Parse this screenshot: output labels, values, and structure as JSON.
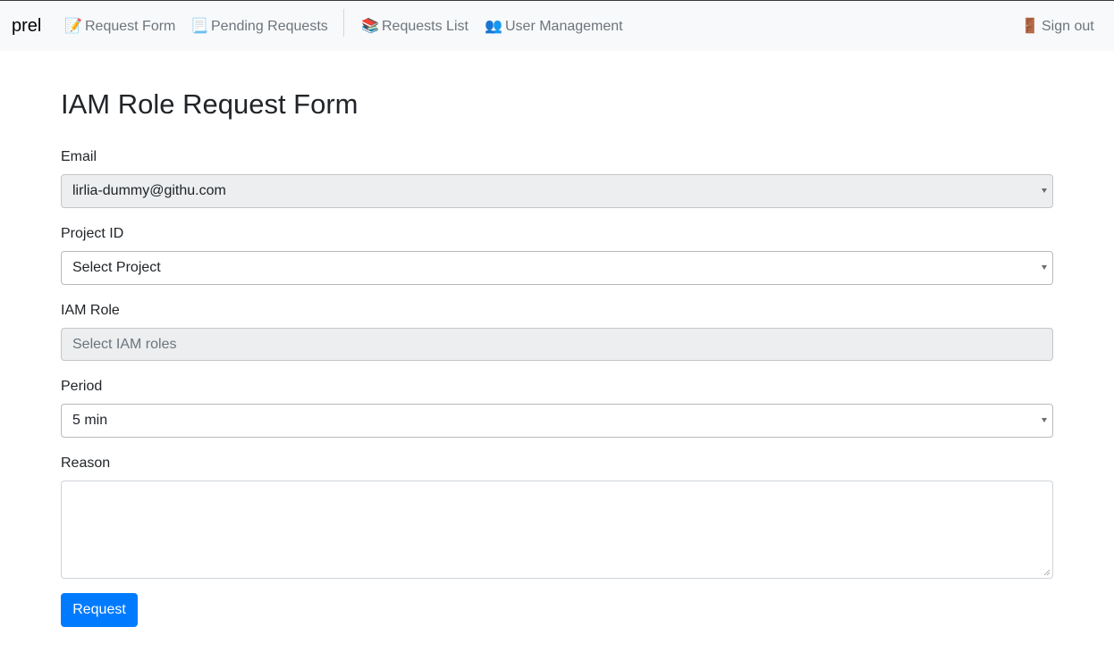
{
  "app": {
    "brand": "prel"
  },
  "nav": {
    "items": [
      {
        "icon": "memo-icon",
        "glyph": "📝",
        "label": "Request Form"
      },
      {
        "icon": "page-icon",
        "glyph": "📃",
        "label": "Pending Requests"
      },
      {
        "icon": "books-icon",
        "glyph": "📚",
        "label": "Requests List"
      },
      {
        "icon": "users-icon",
        "glyph": "👥",
        "label": "User Management"
      }
    ],
    "sign_out": {
      "icon": "door-icon",
      "glyph": "🚪",
      "label": "Sign out"
    }
  },
  "form": {
    "title": "IAM Role Request Form",
    "email": {
      "label": "Email",
      "value": "lirlia-dummy@githu.com"
    },
    "project": {
      "label": "Project ID",
      "value": "Select Project"
    },
    "iam_role": {
      "label": "IAM Role",
      "placeholder": "Select IAM roles"
    },
    "period": {
      "label": "Period",
      "value": "5 min"
    },
    "reason": {
      "label": "Reason",
      "value": ""
    },
    "submit_label": "Request"
  },
  "colors": {
    "primary": "#007bff",
    "navbar_bg": "#f8f9fa",
    "nav_text": "#6c757d",
    "disabled_bg": "#eceeef"
  }
}
